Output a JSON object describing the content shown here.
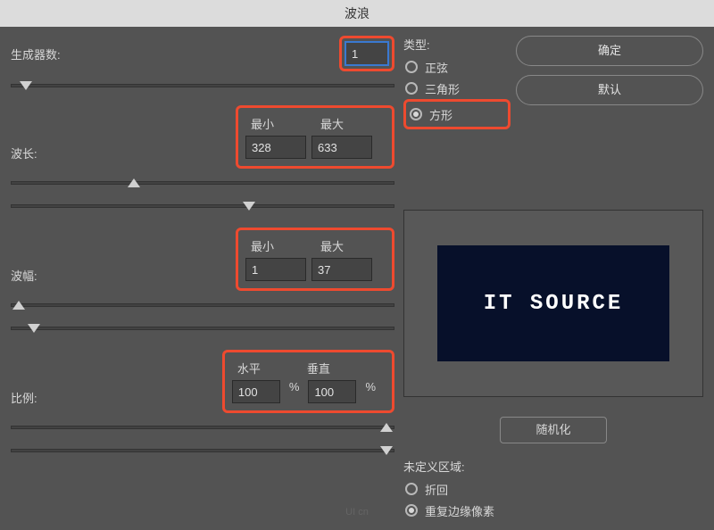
{
  "title": "波浪",
  "generators": {
    "label": "生成器数:",
    "value": "1"
  },
  "wavelength": {
    "label": "波长:",
    "min_label": "最小",
    "max_label": "最大",
    "min": "328",
    "max": "633"
  },
  "amplitude": {
    "label": "波幅:",
    "min_label": "最小",
    "max_label": "最大",
    "min": "1",
    "max": "37"
  },
  "scale": {
    "label": "比例:",
    "h_label": "水平",
    "v_label": "垂直",
    "horiz": "100",
    "vert": "100",
    "pct": "%"
  },
  "type": {
    "title": "类型:",
    "sine": "正弦",
    "triangle": "三角形",
    "square": "方形",
    "selected": "square"
  },
  "buttons": {
    "ok": "确定",
    "defaults": "默认",
    "randomize": "随机化"
  },
  "undefined_area": {
    "title": "未定义区域:",
    "wrap": "折回",
    "repeat_edge": "重复边缘像素",
    "selected": "repeat_edge"
  },
  "preview_text": "IT SOURCE"
}
